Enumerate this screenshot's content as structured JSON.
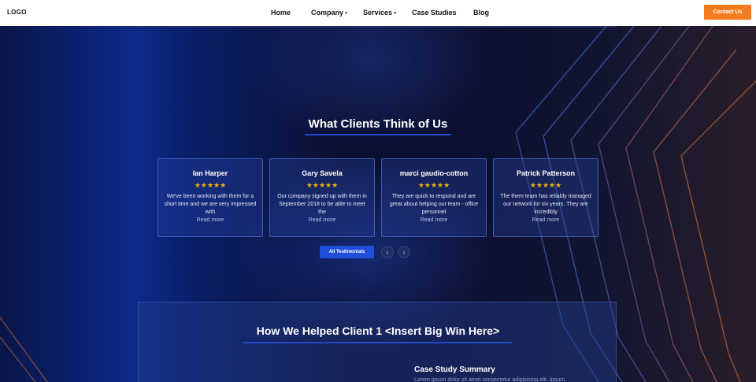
{
  "nav": {
    "logo": "LOGO",
    "items": [
      {
        "label": "Home",
        "dropdown": false
      },
      {
        "label": "Company",
        "dropdown": true
      },
      {
        "label": "Services",
        "dropdown": true
      },
      {
        "label": "Case Studies",
        "dropdown": false
      },
      {
        "label": "Blog",
        "dropdown": false
      }
    ],
    "contact_label": "Contact Us"
  },
  "testimonials": {
    "title": "What Clients Think of Us",
    "cards": [
      {
        "name": "Ian Harper",
        "stars": "★★★★★",
        "text": "We've been working with them for a short time and we are very impressed with",
        "read_more": "Read more"
      },
      {
        "name": "Gary Savela",
        "stars": "★★★★★",
        "text": "Our company signed up with them in September 2018 to be able to meet the",
        "read_more": "Read more"
      },
      {
        "name": "marci gaudio-cotton",
        "stars": "★★★★★",
        "text": "They are quick to respond and are great about helping our team - office personnel",
        "read_more": "Read more"
      },
      {
        "name": "Patrick Patterson",
        "stars": "★★★★★",
        "text": "The them team has reliably managed our network for six years. They are incredibly",
        "read_more": "Read more"
      }
    ],
    "all_label": "All Testimonials",
    "prev_icon": "‹",
    "next_icon": "›"
  },
  "case_study": {
    "title": "How We Helped Client 1 <Insert Big Win Here>",
    "summary_title": "Case Study Summary",
    "summary_text": "Lorem ipsum dolor sit amet consectetur adipisicing elit. Ipsum"
  },
  "colors": {
    "accent_orange": "#f47c1f",
    "accent_blue": "#1f4fd8",
    "star": "#f5b400"
  }
}
